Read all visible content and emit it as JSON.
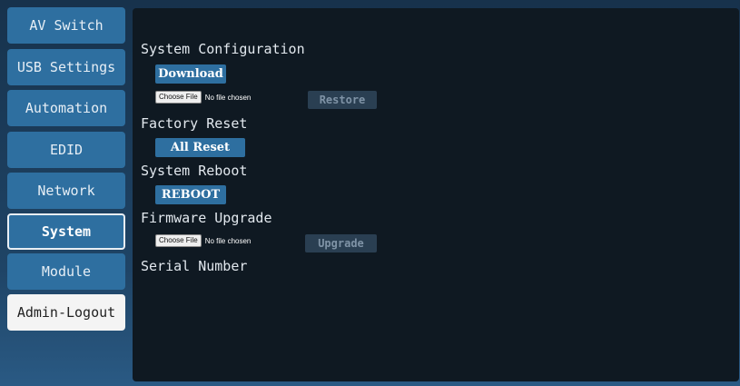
{
  "sidebar": {
    "items": [
      {
        "label": "AV Switch"
      },
      {
        "label": "USB Settings"
      },
      {
        "label": "Automation"
      },
      {
        "label": "EDID"
      },
      {
        "label": "Network"
      },
      {
        "label": "System"
      },
      {
        "label": "Module"
      },
      {
        "label": "Admin-Logout"
      }
    ],
    "active": "System"
  },
  "system": {
    "config": {
      "title": "System Configuration",
      "download_label": "Download",
      "choose_file_label": "Choose File",
      "no_file_label": "No file chosen",
      "restore_label": "Restore"
    },
    "factory_reset": {
      "title": "Factory Reset",
      "button_label": "All Reset"
    },
    "reboot": {
      "title": "System Reboot",
      "button_label": "REBOOT"
    },
    "firmware": {
      "title": "Firmware Upgrade",
      "choose_file_label": "Choose File",
      "no_file_label": "No file chosen",
      "upgrade_label": "Upgrade"
    },
    "serial": {
      "title": "Serial Number"
    }
  },
  "colors": {
    "accent": "#2e6fa0",
    "panel_bg": "#0f1922",
    "disabled_bg": "#2a3f52"
  }
}
